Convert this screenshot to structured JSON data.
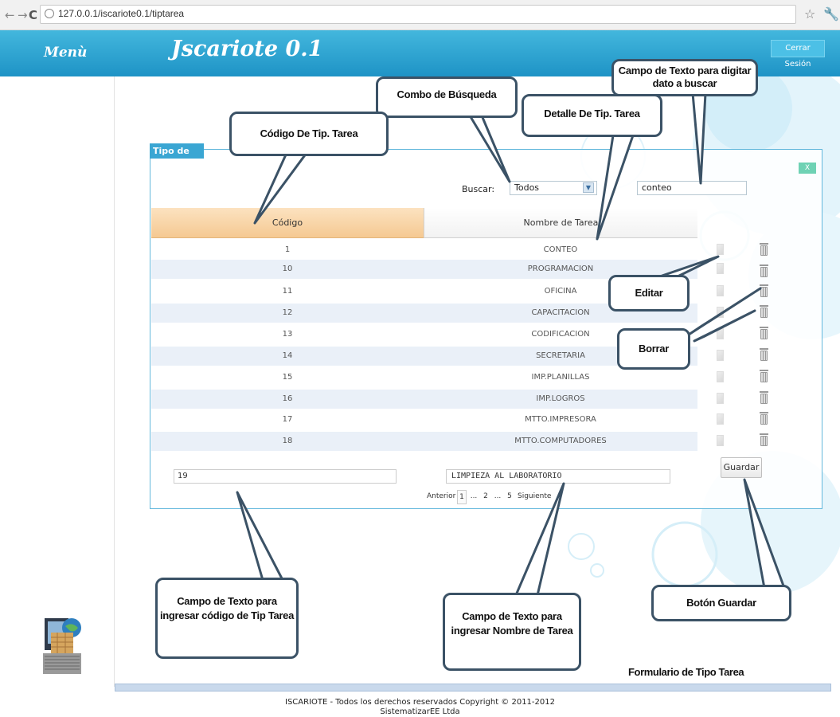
{
  "browser": {
    "url": "127.0.0.1/iscariote0.1/tiptarea"
  },
  "header": {
    "menu_label": "Menù",
    "app_title": "Jscariote 0.1",
    "logout_label": "Cerrar Sesión",
    "color": "#2ba3d4"
  },
  "panel": {
    "legend": "Tipo de Tarea",
    "close_label": "X",
    "search_label": "Buscar:",
    "search_combo_value": "Todos",
    "search_text_value": "conteo"
  },
  "table": {
    "headers": [
      "Código",
      "Nombre de Tarea"
    ],
    "rows": [
      {
        "code": "1",
        "name": "CONTEO"
      },
      {
        "code": "10",
        "name": "PROGRAMACION"
      },
      {
        "code": "11",
        "name": "OFICINA"
      },
      {
        "code": "12",
        "name": "CAPACITACION"
      },
      {
        "code": "13",
        "name": "CODIFICACION"
      },
      {
        "code": "14",
        "name": "SECRETARIA"
      },
      {
        "code": "15",
        "name": "IMP.PLANILLAS"
      },
      {
        "code": "16",
        "name": "IMP.LOGROS"
      },
      {
        "code": "17",
        "name": "MTTO.IMPRESORA"
      },
      {
        "code": "18",
        "name": "MTTO.COMPUTADORES"
      }
    ]
  },
  "form": {
    "code_value": "19",
    "name_value": "LIMPIEZA AL LABORATORIO",
    "save_label": "Guardar"
  },
  "pager": {
    "prev": "Anterior",
    "p1": "1",
    "dots1": "...",
    "p2": "2",
    "dots2": "...",
    "p5": "5",
    "next": "Siguiente"
  },
  "callouts": {
    "combo": "Combo de Búsqueda",
    "search_field": "Campo de Texto para digitar dato a buscar",
    "code_header": "Código De Tip. Tarea",
    "name_header": "Detalle De Tip. Tarea",
    "edit": "Editar",
    "delete": "Borrar",
    "code_field": "Campo de Texto para ingresar código de Tip Tarea",
    "name_field": "Campo de Texto para ingresar Nombre de Tarea",
    "save_button": "Botón Guardar"
  },
  "caption": "Formulario de Tipo Tarea",
  "footer": {
    "line1": "ISCARIOTE - Todos los derechos reservados Copyright © 2011-2012",
    "line2": "SistematizarEE Ltda"
  }
}
